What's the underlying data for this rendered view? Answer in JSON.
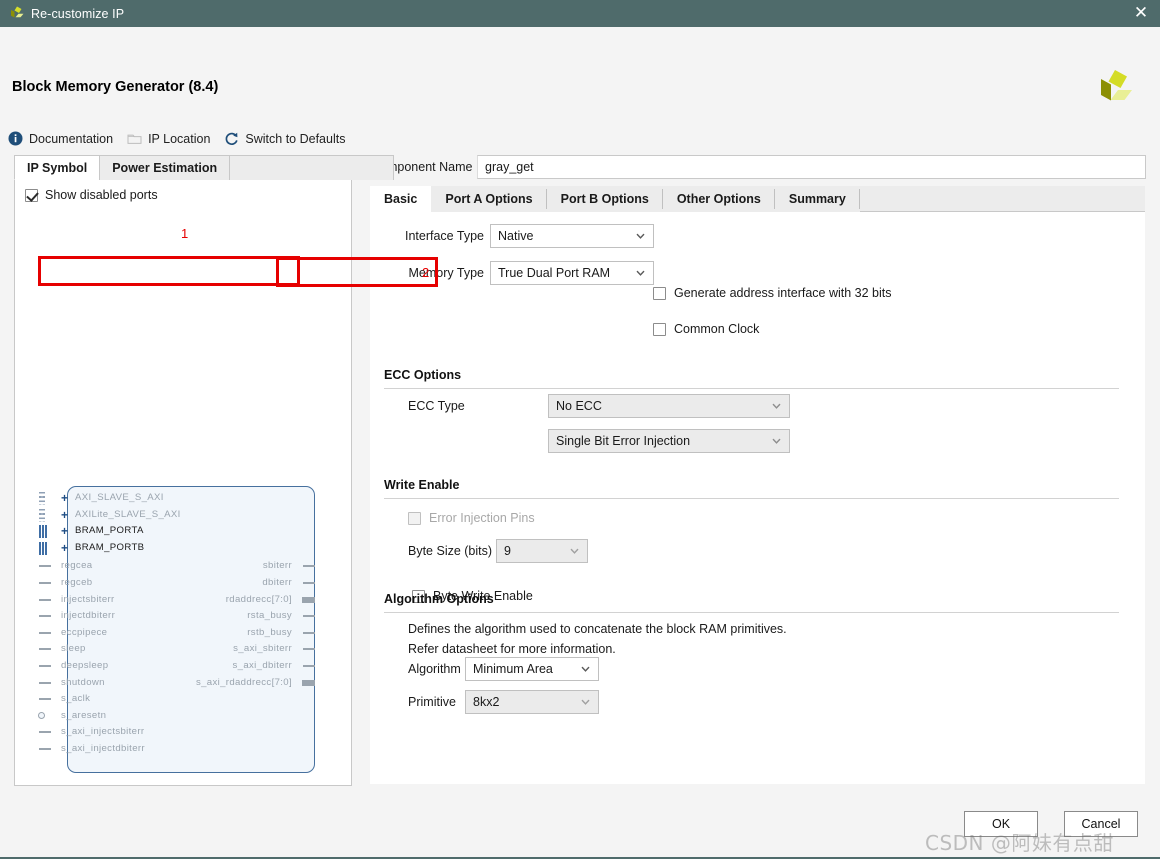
{
  "window": {
    "title": "Re-customize IP",
    "close_label": "✕",
    "titlebar_color": "#4f6b6b"
  },
  "header": {
    "app_title": "Block Memory Generator (8.4)",
    "logo_name": "xilinx-logo"
  },
  "toolbar": {
    "items": [
      {
        "label": "Documentation",
        "icon": "info-icon"
      },
      {
        "label": "IP Location",
        "icon": "folder-icon"
      },
      {
        "label": "Switch to Defaults",
        "icon": "refresh-icon"
      }
    ]
  },
  "left_panel": {
    "tabs": [
      {
        "label": "IP Symbol",
        "active": true
      },
      {
        "label": "Power Estimation",
        "active": false
      }
    ],
    "show_disabled_ports": {
      "label": "Show disabled ports",
      "checked": true
    },
    "symbol": {
      "buses": [
        {
          "name": "AXI_SLAVE_S_AXI",
          "enabled": false,
          "mark": "dots"
        },
        {
          "name": "AXILite_SLAVE_S_AXI",
          "enabled": false,
          "mark": "dots"
        },
        {
          "name": "BRAM_PORTA",
          "enabled": true,
          "mark": "bars"
        },
        {
          "name": "BRAM_PORTB",
          "enabled": true,
          "mark": "bars"
        }
      ],
      "inputs": [
        {
          "name": "regcea",
          "type": "pin"
        },
        {
          "name": "regceb",
          "type": "pin"
        },
        {
          "name": "injectsbiterr",
          "type": "pin"
        },
        {
          "name": "injectdbiterr",
          "type": "pin"
        },
        {
          "name": "eccpipece",
          "type": "pin"
        },
        {
          "name": "sleep",
          "type": "pin"
        },
        {
          "name": "deepsleep",
          "type": "pin"
        },
        {
          "name": "shutdown",
          "type": "pin"
        },
        {
          "name": "s_aclk",
          "type": "pin"
        },
        {
          "name": "s_aresetn",
          "type": "bubble"
        },
        {
          "name": "s_axi_injectsbiterr",
          "type": "pin"
        },
        {
          "name": "s_axi_injectdbiterr",
          "type": "pin"
        }
      ],
      "outputs": [
        {
          "name": "sbiterr",
          "type": "pin"
        },
        {
          "name": "dbiterr",
          "type": "pin"
        },
        {
          "name": "rdaddrecc[7:0]",
          "type": "bus"
        },
        {
          "name": "rsta_busy",
          "type": "pin"
        },
        {
          "name": "rstb_busy",
          "type": "pin"
        },
        {
          "name": "s_axi_sbiterr",
          "type": "pin"
        },
        {
          "name": "s_axi_dbiterr",
          "type": "pin"
        },
        {
          "name": "s_axi_rdaddrecc[7:0]",
          "type": "bus"
        }
      ]
    }
  },
  "component": {
    "label": "Component Name",
    "value": "gray_get"
  },
  "tabs": [
    {
      "label": "Basic",
      "active": true
    },
    {
      "label": "Port A Options",
      "active": false
    },
    {
      "label": "Port B Options",
      "active": false
    },
    {
      "label": "Other Options",
      "active": false
    },
    {
      "label": "Summary",
      "active": false
    }
  ],
  "basic": {
    "interface_type": {
      "label": "Interface Type",
      "value": "Native"
    },
    "memory_type": {
      "label": "Memory Type",
      "value": "True Dual Port RAM"
    },
    "generate_address_interface": {
      "label": "Generate address interface with 32 bits",
      "checked": false
    },
    "common_clock": {
      "label": "Common Clock",
      "checked": false
    }
  },
  "ecc": {
    "section_title": "ECC Options",
    "ecc_type": {
      "label": "ECC Type",
      "value": "No ECC"
    },
    "error_injection_pins": {
      "label": "Error Injection Pins",
      "checked": false,
      "value": "Single Bit Error Injection"
    }
  },
  "write_enable": {
    "section_title": "Write Enable",
    "byte_write_enable": {
      "label": "Byte Write Enable",
      "checked": false
    },
    "byte_size": {
      "label": "Byte Size (bits)",
      "value": "9"
    }
  },
  "algorithm": {
    "section_title": "Algorithm Options",
    "description_line1": "Defines the algorithm used to concatenate the block RAM primitives.",
    "description_line2": "Refer datasheet for more information.",
    "algorithm": {
      "label": "Algorithm",
      "value": "Minimum Area"
    },
    "primitive": {
      "label": "Primitive",
      "value": "8kx2"
    }
  },
  "annotations": {
    "marker_1": "1",
    "marker_2": "2",
    "color": "#e60000"
  },
  "footer": {
    "ok_label": "OK",
    "cancel_label": "Cancel"
  },
  "watermark": {
    "text": "CSDN @阿妹有点甜"
  }
}
